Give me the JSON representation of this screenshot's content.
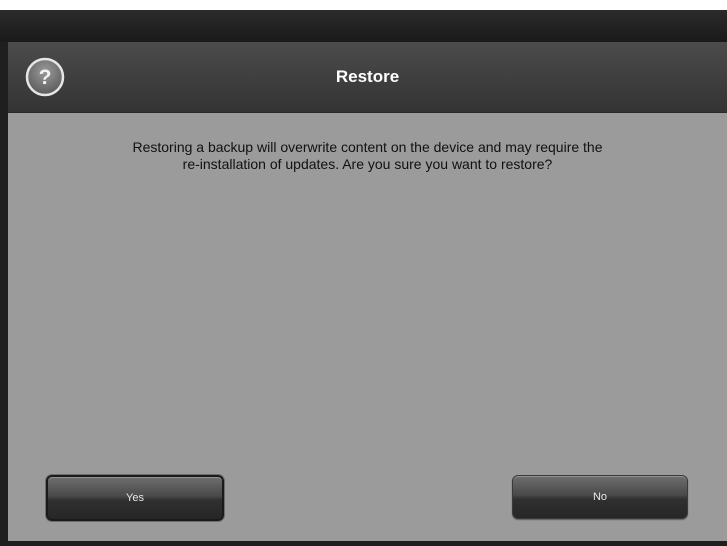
{
  "dialog": {
    "title": "Restore",
    "help_icon": "question-mark-circle-icon",
    "message_line1": "Restoring a backup will overwrite content on the device and may require the",
    "message_line2": "re-installation of updates. Are you sure you want to restore?",
    "yes_label": "Yes",
    "no_label": "No"
  },
  "colors": {
    "title_bar": "#3e3e3e",
    "body_background": "#9b9b9b",
    "button": "#3a3a3a",
    "text_dark": "#111111",
    "text_light": "#ffffff"
  }
}
